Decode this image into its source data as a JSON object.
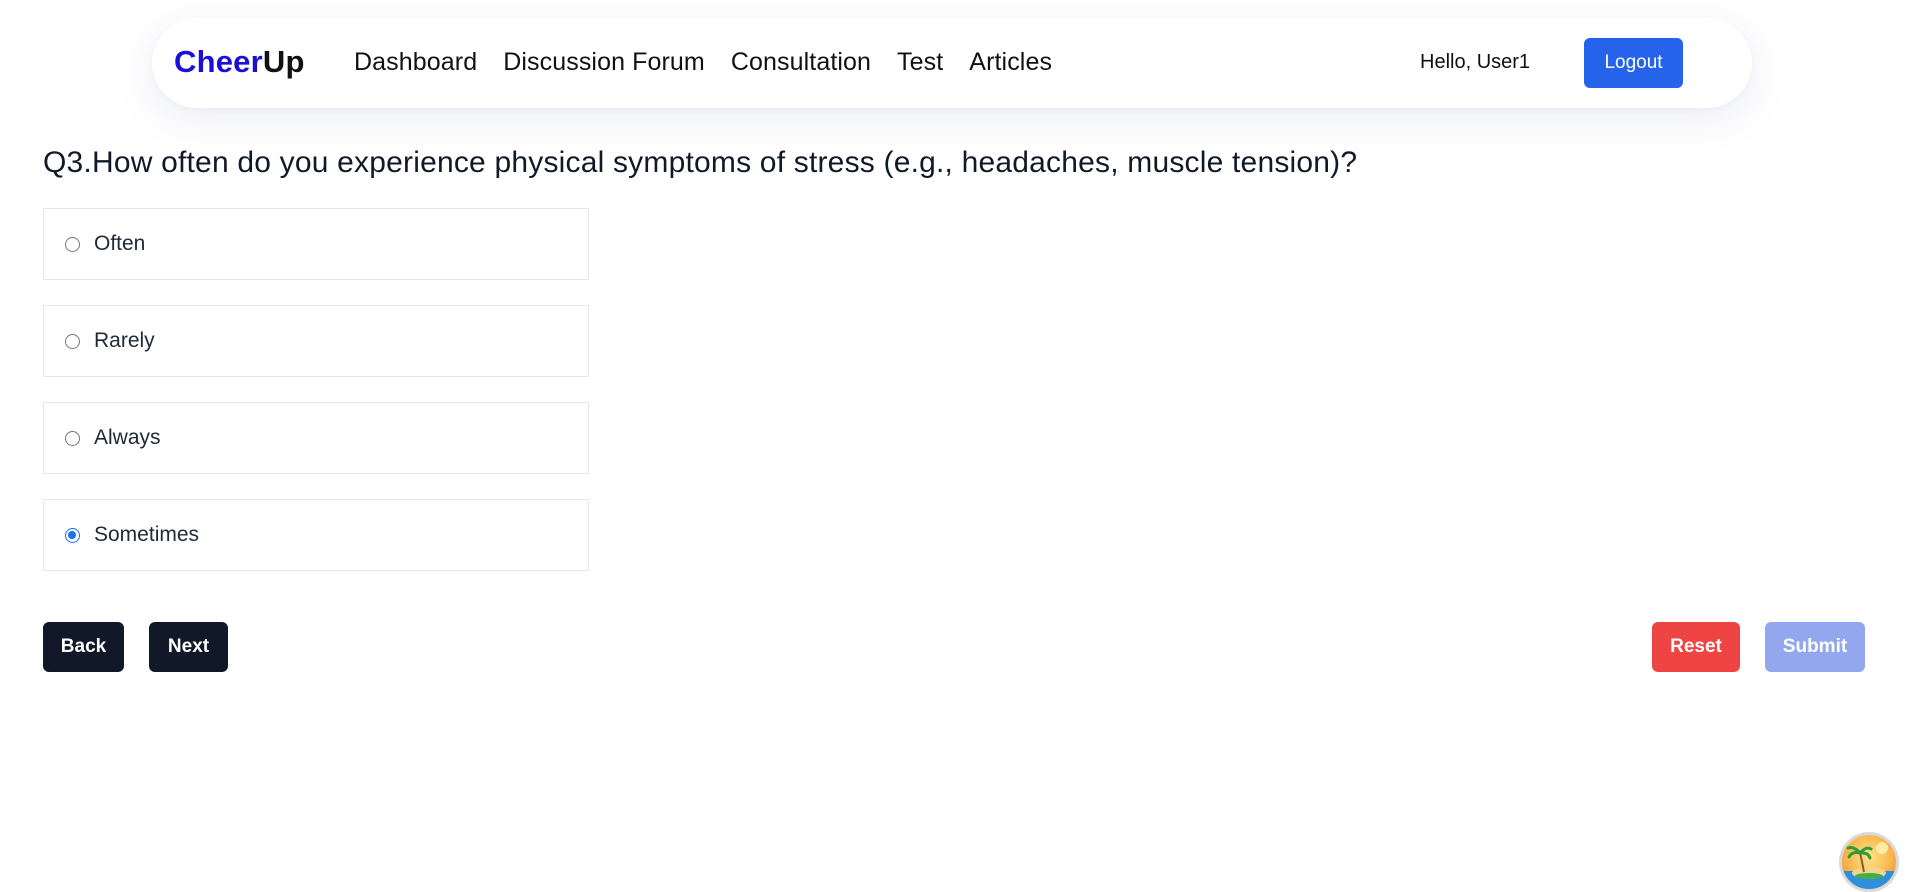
{
  "header": {
    "brand_part1": "Cheer",
    "brand_part2": "Up",
    "nav": [
      "Dashboard",
      "Discussion Forum",
      "Consultation",
      "Test",
      "Articles"
    ],
    "greeting": "Hello, User1",
    "logout_label": "Logout"
  },
  "quiz": {
    "question": "Q3.How often do you experience physical symptoms of stress (e.g., headaches, muscle tension)?",
    "options": [
      {
        "label": "Often",
        "selected": false
      },
      {
        "label": "Rarely",
        "selected": false
      },
      {
        "label": "Always",
        "selected": false
      },
      {
        "label": "Sometimes",
        "selected": true
      }
    ]
  },
  "actions": {
    "back_label": "Back",
    "next_label": "Next",
    "reset_label": "Reset",
    "submit_label": "Submit"
  },
  "colors": {
    "brand_blue": "#1a0fd6",
    "primary": "#2563eb",
    "dark": "#111827",
    "danger": "#ef4444",
    "disabled_primary": "#93a7ef"
  },
  "icons": {
    "chat_avatar": "island-avatar-icon"
  }
}
